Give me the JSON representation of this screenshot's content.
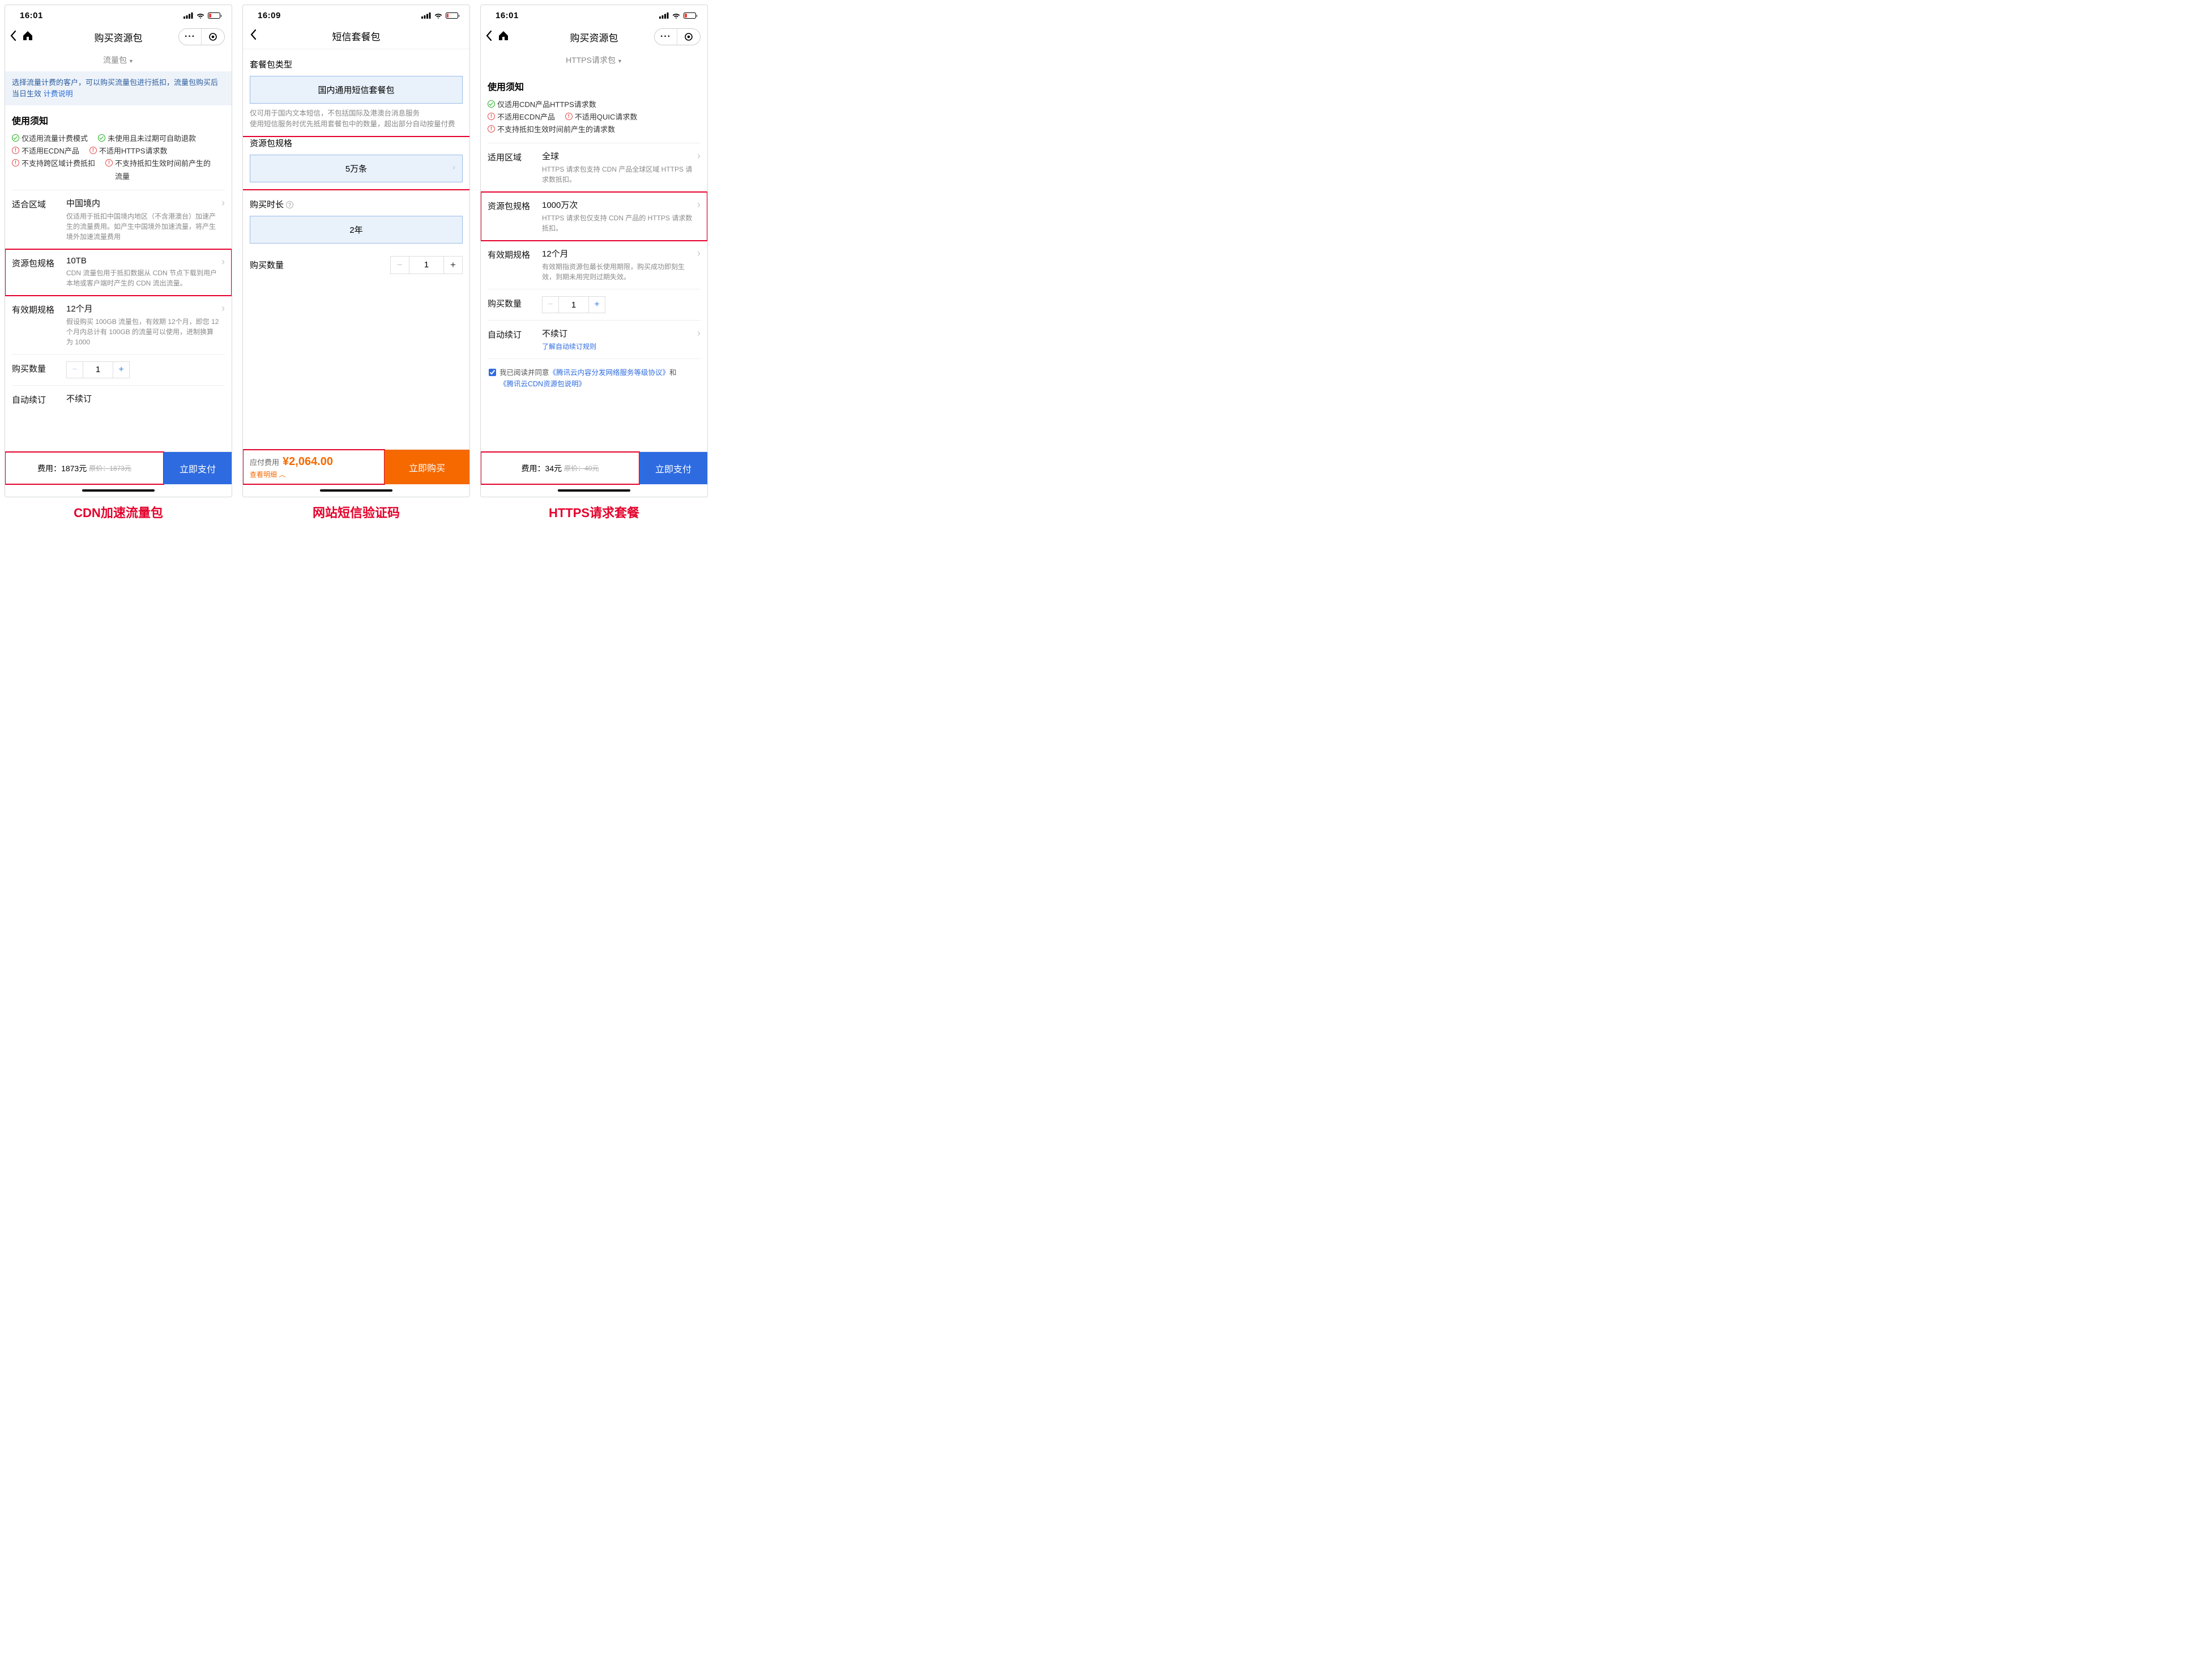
{
  "captions": [
    "CDN加速流量包",
    "网站短信验证码",
    "HTTPS请求套餐"
  ],
  "p1": {
    "time": "16:01",
    "batt": "19",
    "title": "购买资源包",
    "subnav": "流量包",
    "banner_a": "选择流量计费的客户，可以购买流量包进行抵扣，流量包购买后当日生效 ",
    "banner_link": "计费说明",
    "usage_title": "使用须知",
    "notes": [
      {
        "t": "ok",
        "txt": "仅适用流量计费模式"
      },
      {
        "t": "ok",
        "txt": "未使用且未过期可自助退款"
      },
      {
        "t": "no",
        "txt": "不适用ECDN产品"
      },
      {
        "t": "no",
        "txt": "不适用HTTPS请求数"
      },
      {
        "t": "no",
        "txt": "不支持跨区域计费抵扣"
      },
      {
        "t": "no",
        "txt": "不支持抵扣生效时间前产生的流量"
      }
    ],
    "region_lbl": "适合区域",
    "region_v": "中国境内",
    "region_d": "仅适用于抵扣中国境内地区（不含港澳台）加速产生的流量费用。如产生中国境外加速流量，将产生境外加速流量费用",
    "spec_lbl": "资源包规格",
    "spec_v": "10TB",
    "spec_d": "CDN 流量包用于抵扣数据从 CDN 节点下载到用户本地或客户端时产生的 CDN 流出流量。",
    "valid_lbl": "有效期规格",
    "valid_v": "12个月",
    "valid_d": "假设购买 100GB 流量包，有效期 12个月，即您 12 个月内总计有 100GB 的流量可以使用，进制换算为 1000",
    "qty_lbl": "购买数量",
    "qty_v": "1",
    "renew_lbl": "自动续订",
    "renew_v": "不续订",
    "fee_lbl": "费用：",
    "fee_v": "1873元",
    "fee_orig": "原价：1873元",
    "pay": "立即支付"
  },
  "p2": {
    "time": "16:09",
    "batt": "16",
    "title": "短信套餐包",
    "type_lbl": "套餐包类型",
    "type_v": "国内通用短信套餐包",
    "type_hint": "仅可用于国内文本短信，不包括国际及港澳台消息服务\n使用短信服务时优先抵用套餐包中的数量，超出部分自动按量付费",
    "spec_lbl": "资源包规格",
    "spec_v": "5万条",
    "dur_lbl": "购买时长",
    "dur_v": "2年",
    "qty_lbl": "购买数量",
    "qty_v": "1",
    "price_lbl": "应付费用",
    "price_v": "¥2,064.00",
    "detail": "查看明细",
    "buy": "立即购买"
  },
  "p3": {
    "time": "16:01",
    "batt": "19",
    "title": "购买资源包",
    "subnav": "HTTPS请求包",
    "usage_title": "使用须知",
    "notes": [
      {
        "t": "ok",
        "txt": "仅适用CDN产品HTTPS请求数"
      },
      {
        "t": "no",
        "txt": "不适用ECDN产品"
      },
      {
        "t": "no",
        "txt": "不适用QUIC请求数"
      },
      {
        "t": "no",
        "txt": "不支持抵扣生效时间前产生的请求数"
      }
    ],
    "region_lbl": "适用区域",
    "region_v": "全球",
    "region_d": "HTTPS 请求包支持 CDN 产品全球区域 HTTPS 请求数抵扣。",
    "spec_lbl": "资源包规格",
    "spec_v": "1000万次",
    "spec_d": "HTTPS 请求包仅支持 CDN 产品的 HTTPS 请求数抵扣。",
    "valid_lbl": "有效期规格",
    "valid_v": "12个月",
    "valid_d": "有效期指资源包最长使用期限，购买成功即刻生效，到期未用完则过期失效。",
    "qty_lbl": "购买数量",
    "qty_v": "1",
    "renew_lbl": "自动续订",
    "renew_v": "不续订",
    "renew_link": "了解自动续订规则",
    "agree_a": "我已阅读并同意",
    "agree_l1": "《腾讯云内容分发网络服务等级协议》",
    "agree_mid": "和",
    "agree_l2": "《腾讯云CDN资源包说明》",
    "fee_lbl": "费用：",
    "fee_v": "34元",
    "fee_orig": "原价：40元",
    "pay": "立即支付"
  }
}
